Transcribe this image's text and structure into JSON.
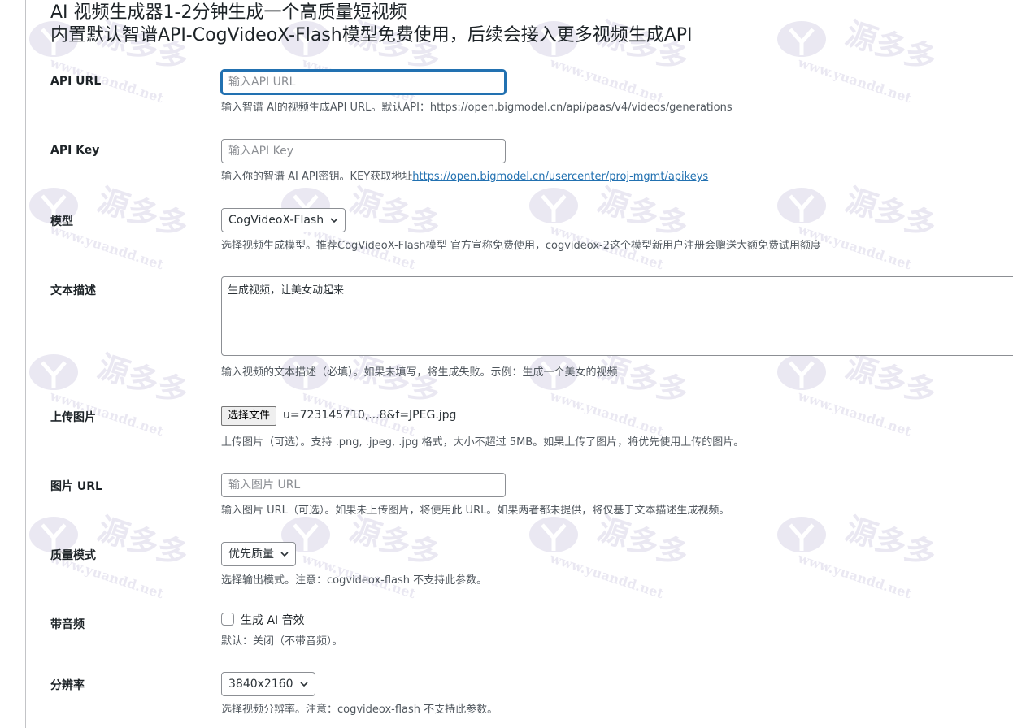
{
  "heading": {
    "line1": "AI 视频生成器1-2分钟生成一个高质量短视频",
    "line2": "内置默认智谱API-CogVideoX-Flash模型免费使用，后续会接入更多视频生成API"
  },
  "api_url": {
    "label": "API URL",
    "placeholder": "输入API URL",
    "description": "输入智谱 AI的视频生成API URL。默认API：https://open.bigmodel.cn/api/paas/v4/videos/generations"
  },
  "api_key": {
    "label": "API Key",
    "placeholder": "输入API Key",
    "description_prefix": "输入你的智谱 AI API密钥。KEY获取地址",
    "link_text": "https://open.bigmodel.cn/usercenter/proj-mgmt/apikeys"
  },
  "model": {
    "label": "模型",
    "selected": "CogVideoX-Flash",
    "description": "选择视频生成模型。推荐CogVideoX-Flash模型 官方宣称免费使用，cogvideox-2这个模型新用户注册会赠送大额免费试用额度"
  },
  "prompt": {
    "label": "文本描述",
    "value": "生成视频，让美女动起来",
    "description": "输入视频的文本描述（必填）。如果未填写，将生成失败。示例：生成一个美女的视频"
  },
  "upload": {
    "label": "上传图片",
    "button_label": "选择文件",
    "file_name": "u=723145710,...8&f=JPEG.jpg",
    "description": "上传图片（可选）。支持 .png, .jpeg, .jpg 格式，大小不超过 5MB。如果上传了图片，将优先使用上传的图片。"
  },
  "image_url": {
    "label": "图片 URL",
    "placeholder": "输入图片 URL",
    "description": "输入图片 URL（可选）。如果未上传图片，将使用此 URL。如果两者都未提供，将仅基于文本描述生成视频。"
  },
  "quality": {
    "label": "质量模式",
    "selected": "优先质量",
    "description": "选择输出模式。注意：cogvideox-flash 不支持此参数。"
  },
  "audio": {
    "label": "带音频",
    "checkbox_label": "生成 AI 音效",
    "checked": false,
    "description": "默认：关闭（不带音频）。"
  },
  "resolution": {
    "label": "分辨率",
    "selected": "3840x2160",
    "description": "选择视频分辨率。注意：cogvideox-flash 不支持此参数。"
  },
  "watermark": {
    "text": "源多多",
    "url": "www.yuandd.net",
    "color": "#d9d6e8"
  },
  "colors": {
    "accent": "#2271b1",
    "text": "#1d2327",
    "description": "#50575e",
    "border": "#8c8f94"
  }
}
